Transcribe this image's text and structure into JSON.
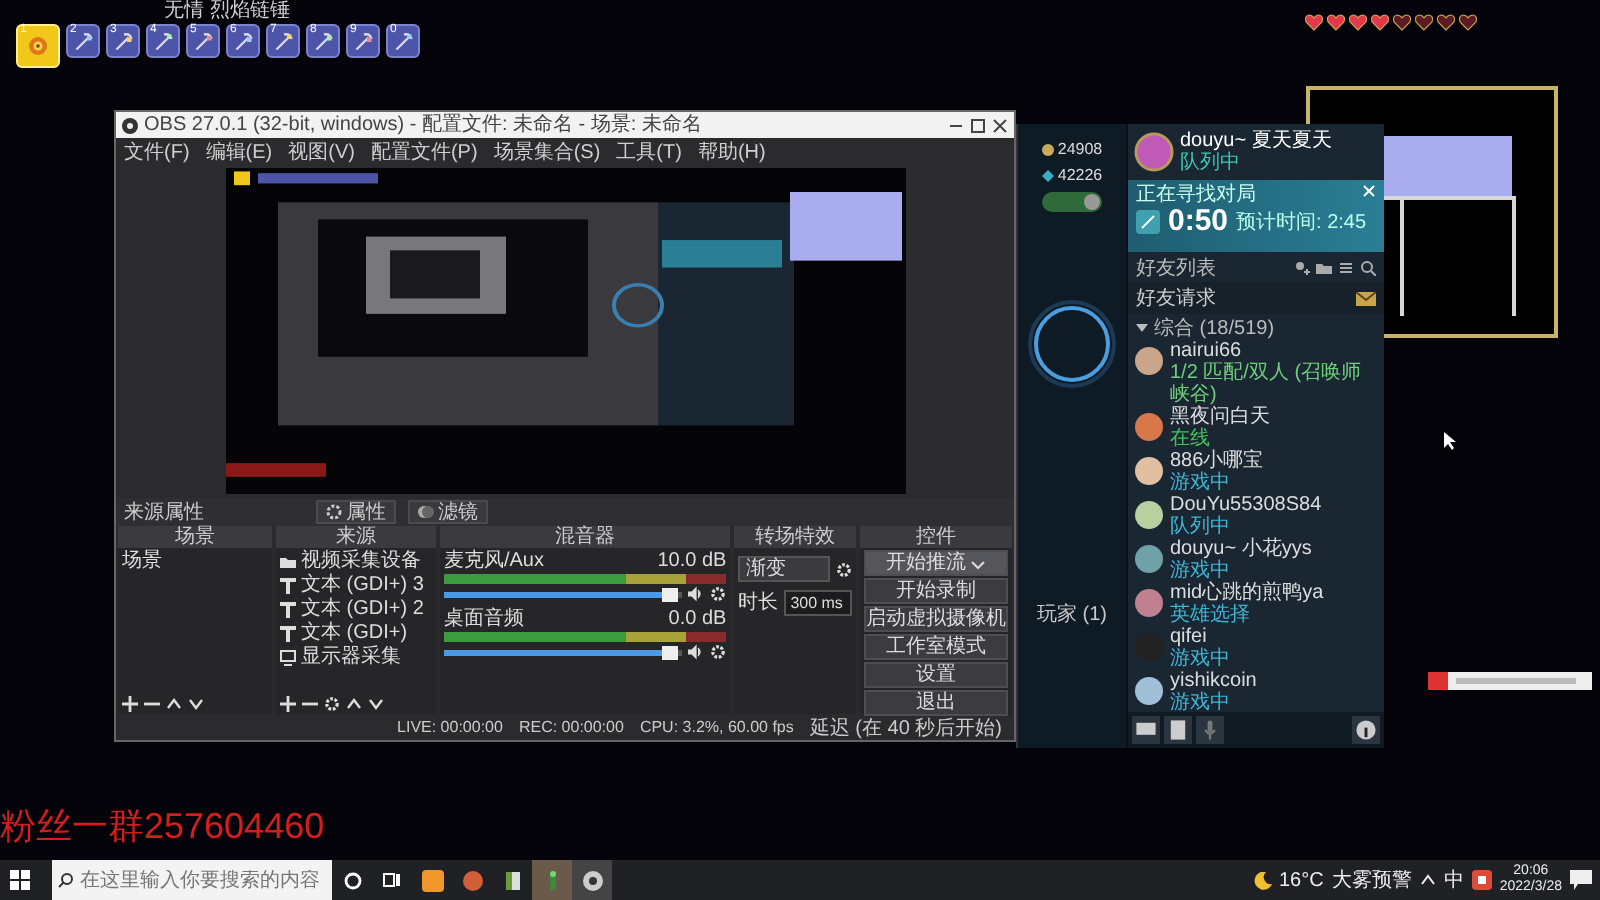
{
  "game_hud": {
    "item_name": "无情 烈焰链锤",
    "hotbar": [
      {
        "number": "1",
        "selected": true
      },
      {
        "number": "2",
        "selected": false
      },
      {
        "number": "3",
        "selected": false
      },
      {
        "number": "4",
        "selected": false
      },
      {
        "number": "5",
        "selected": false
      },
      {
        "number": "6",
        "selected": false
      },
      {
        "number": "7",
        "selected": false
      },
      {
        "number": "8",
        "selected": false
      },
      {
        "number": "9",
        "selected": false
      },
      {
        "number": "0",
        "selected": false
      }
    ],
    "hearts": [
      {
        "filled": true
      },
      {
        "filled": true
      },
      {
        "filled": true
      },
      {
        "filled": true
      },
      {
        "filled": false
      },
      {
        "filled": false
      },
      {
        "filled": false
      },
      {
        "filled": false
      }
    ]
  },
  "obs": {
    "title": "OBS 27.0.1 (32-bit, windows) - 配置文件: 未命名 - 场景: 未命名",
    "menu": [
      "文件(F)",
      "编辑(E)",
      "视图(V)",
      "配置文件(P)",
      "场景集合(S)",
      "工具(T)",
      "帮助(H)"
    ],
    "properties_bar": {
      "label": "来源属性",
      "buttons": [
        "属性",
        "滤镜"
      ]
    },
    "docks": {
      "scenes": {
        "title": "场景",
        "items": [
          "场景"
        ]
      },
      "sources": {
        "title": "来源",
        "items": [
          {
            "name": "视频采集设备",
            "kind": "camera"
          },
          {
            "name": "文本 (GDI+) 3",
            "kind": "text"
          },
          {
            "name": "文本 (GDI+) 2",
            "kind": "text"
          },
          {
            "name": "文本 (GDI+)",
            "kind": "text"
          },
          {
            "name": "显示器采集",
            "kind": "monitor"
          }
        ]
      },
      "mixer": {
        "title": "混音器",
        "channels": [
          {
            "name": "麦克风/Aux",
            "reading": "10.0 dB",
            "level": 0.95
          },
          {
            "name": "桌面音频",
            "reading": "0.0 dB",
            "level": 0.95
          }
        ]
      },
      "transitions": {
        "title": "转场特效",
        "type": "渐变",
        "duration_label": "时长",
        "duration": "300 ms"
      },
      "controls": {
        "title": "控件",
        "buttons": [
          {
            "label": "开始推流",
            "kind": "dropdown"
          },
          {
            "label": "开始录制",
            "kind": "button"
          },
          {
            "label": "启动虚拟摄像机",
            "kind": "button"
          },
          {
            "label": "工作室模式",
            "kind": "button"
          },
          {
            "label": "设置",
            "kind": "button"
          },
          {
            "label": "退出",
            "kind": "button"
          }
        ]
      }
    },
    "status_bar": {
      "live": "LIVE: 00:00:00",
      "rec": "REC: 00:00:00",
      "cpu": "CPU: 3.2%, 60.00 fps",
      "delay": "延迟 (在 40 秒后开始)"
    }
  },
  "client": {
    "currency": [
      "24908",
      "42226"
    ],
    "toggle_on": true,
    "party_label": "玩家 (1)",
    "profile": {
      "name": "douyu~ 夏天夏天",
      "status": "队列中"
    },
    "queue": {
      "title": "正在寻找对局",
      "timer": "0:50",
      "estimate": "预计时间: 2:45"
    },
    "friends_title": "好友列表",
    "requests_label": "好友请求",
    "group": "综合 (18/519)",
    "friends": [
      {
        "name": "nairui66",
        "status": "1/2 匹配/双人 (召唤师峡谷)",
        "color": "#6fcf7c"
      },
      {
        "name": "黑夜问白天",
        "status": "在线",
        "color": "#3fc45a"
      },
      {
        "name": "886小哪宝",
        "status": "游戏中",
        "color": "#3fb6d8"
      },
      {
        "name": "DouYu55308S84",
        "status": "队列中",
        "color": "#3fb6d8"
      },
      {
        "name": "douyu~ 小花yys",
        "status": "游戏中",
        "color": "#3fb6d8"
      },
      {
        "name": "mid心跳的煎鸭ya",
        "status": "英雄选择",
        "color": "#3fb6d8"
      },
      {
        "name": "qifei",
        "status": "游戏中",
        "color": "#3fb6d8"
      },
      {
        "name": "yishikcoin",
        "status": "游戏中",
        "color": "#3fb6d8"
      }
    ]
  },
  "overlay_text": "粉丝一群257604460",
  "taskbar": {
    "search_placeholder": "在这里输入你要搜索的内容",
    "weather": "16°C",
    "weather_alert": "大雾预警",
    "input_method": "中",
    "time": "20:06",
    "date": "2022/3/28"
  }
}
